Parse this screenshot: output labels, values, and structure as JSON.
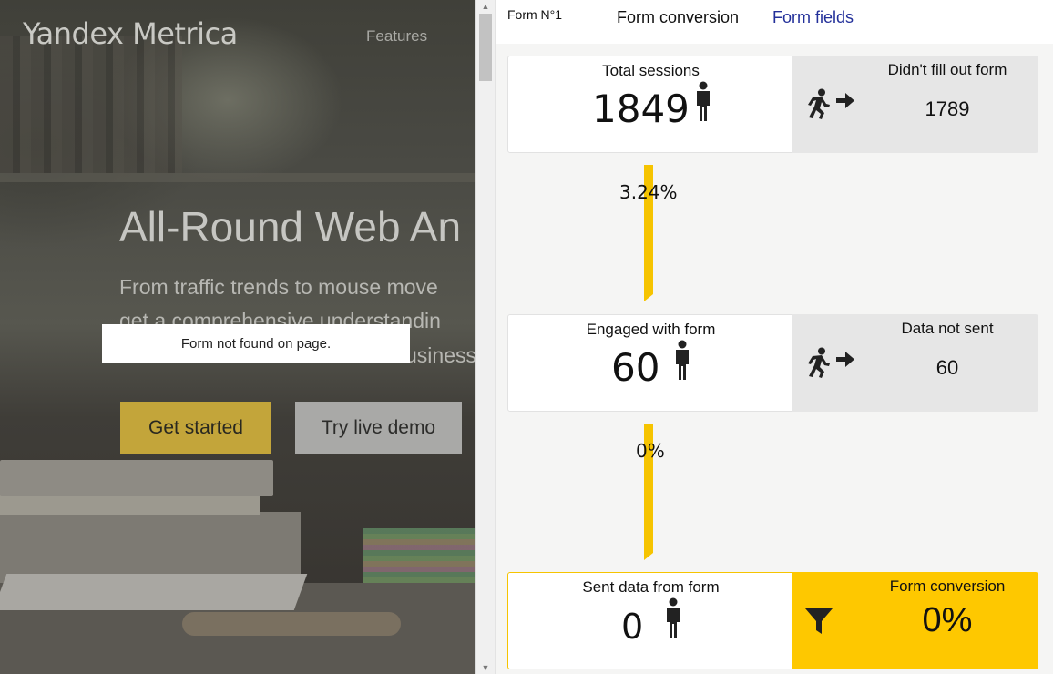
{
  "site": {
    "logo_bold": "Yandex",
    "logo_light": "Metrica",
    "nav_features": "Features",
    "hero_title": "All-Round Web An",
    "hero_line1": "From traffic trends to mouse move",
    "hero_line2": "get a comprehensive understandin",
    "hero_line3": "usiness",
    "btn_get_started": "Get started",
    "btn_try_demo": "Try live demo",
    "form_not_found": "Form not found on page."
  },
  "panel": {
    "form_label": "Form N°1",
    "tab_conversion": "Form conversion",
    "tab_fields": "Form fields",
    "colors": {
      "accent": "#fec800",
      "tab_link": "#23309a"
    },
    "cards": [
      {
        "title": "Total sessions",
        "value": "1849",
        "side_title": "Didn't fill out form",
        "side_value": "1789",
        "side_icon": "running-man-exit-icon"
      },
      {
        "title": "Engaged with form",
        "value": "60",
        "side_title": "Data not sent",
        "side_value": "60",
        "side_icon": "running-man-exit-icon"
      },
      {
        "title": "Sent data from form",
        "value": "0",
        "side_title": "Form conversion",
        "side_value": "0%",
        "side_icon": "funnel-icon"
      }
    ],
    "connectors": [
      "3.24%",
      "0%"
    ]
  }
}
